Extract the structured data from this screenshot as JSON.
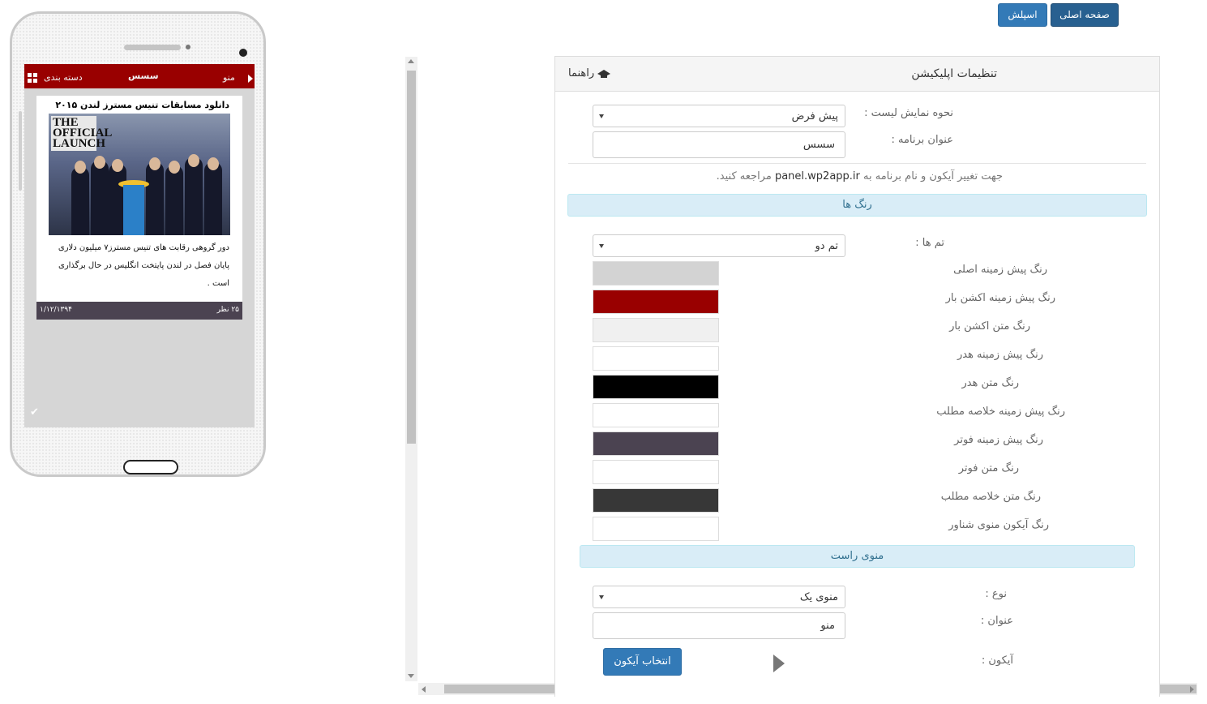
{
  "top_buttons": {
    "home": "صفحه اصلی",
    "splash": "اسپلش"
  },
  "preview": {
    "actionbar": {
      "category_label": "دسته بندی",
      "app_title": "سسس",
      "menu_label": "منو"
    },
    "post": {
      "title": "دانلود مسابقات تنیس مسترز لندن ۲۰۱۵",
      "image_text": "THE OFFICIAL LAUNCH",
      "summary": "دور گروهی رقابت های تنیس مسترز۷ میلیون دلاری پایان فصل در لندن پایتخت انگلیس در حال برگذاری است .",
      "comments": "۲۵ نظر",
      "date": "۱/۱۲/۱۳۹۴"
    },
    "colors": {
      "actionbar_bg": "#990000",
      "screen_bg": "#d6d6d6",
      "footer_bg": "#4b4351"
    }
  },
  "settings": {
    "title": "تنظیمات اپلیکیشن",
    "help": "راهنما",
    "list_display": {
      "label": "نحوه نمایش لیست :",
      "value": "پیش فرض"
    },
    "app_name": {
      "label": "عنوان برنامه :",
      "value": "سسس"
    },
    "note_before": "جهت تغییر آیکون و نام برنامه به",
    "note_domain": "panel.wp2app.ir",
    "note_after": "مراجعه کنید.",
    "colors_section": "رنگ ها",
    "theme": {
      "label": "تم ها :",
      "value": "تم دو"
    },
    "color_fields": [
      {
        "label": "رنگ پیش زمینه اصلی",
        "color": "#d3d3d3"
      },
      {
        "label": "رنگ پیش زمینه اکشن بار",
        "color": "#990000"
      },
      {
        "label": "رنگ متن اکشن بار",
        "color": "#f0f0f0"
      },
      {
        "label": "رنگ پیش زمینه هدر",
        "color": "#ffffff"
      },
      {
        "label": "رنگ متن هدر",
        "color": "#000000"
      },
      {
        "label": "رنگ پیش زمینه خلاصه مطلب",
        "color": "#ffffff"
      },
      {
        "label": "رنگ پیش زمینه فوتر",
        "color": "#4b4351"
      },
      {
        "label": "رنگ متن فوتر",
        "color": "#ffffff"
      },
      {
        "label": "رنگ متن خلاصه مطلب",
        "color": "#373737"
      },
      {
        "label": "رنگ آیکون منوی شناور",
        "color": "#ffffff"
      }
    ],
    "right_menu_section": "منوی راست",
    "menu_type": {
      "label": "نوع :",
      "value": "منوی یک"
    },
    "menu_title": {
      "label": "عنوان :",
      "value": "منو"
    },
    "menu_icon": {
      "label": "آیکون :",
      "button": "انتخاب آیکون"
    }
  }
}
